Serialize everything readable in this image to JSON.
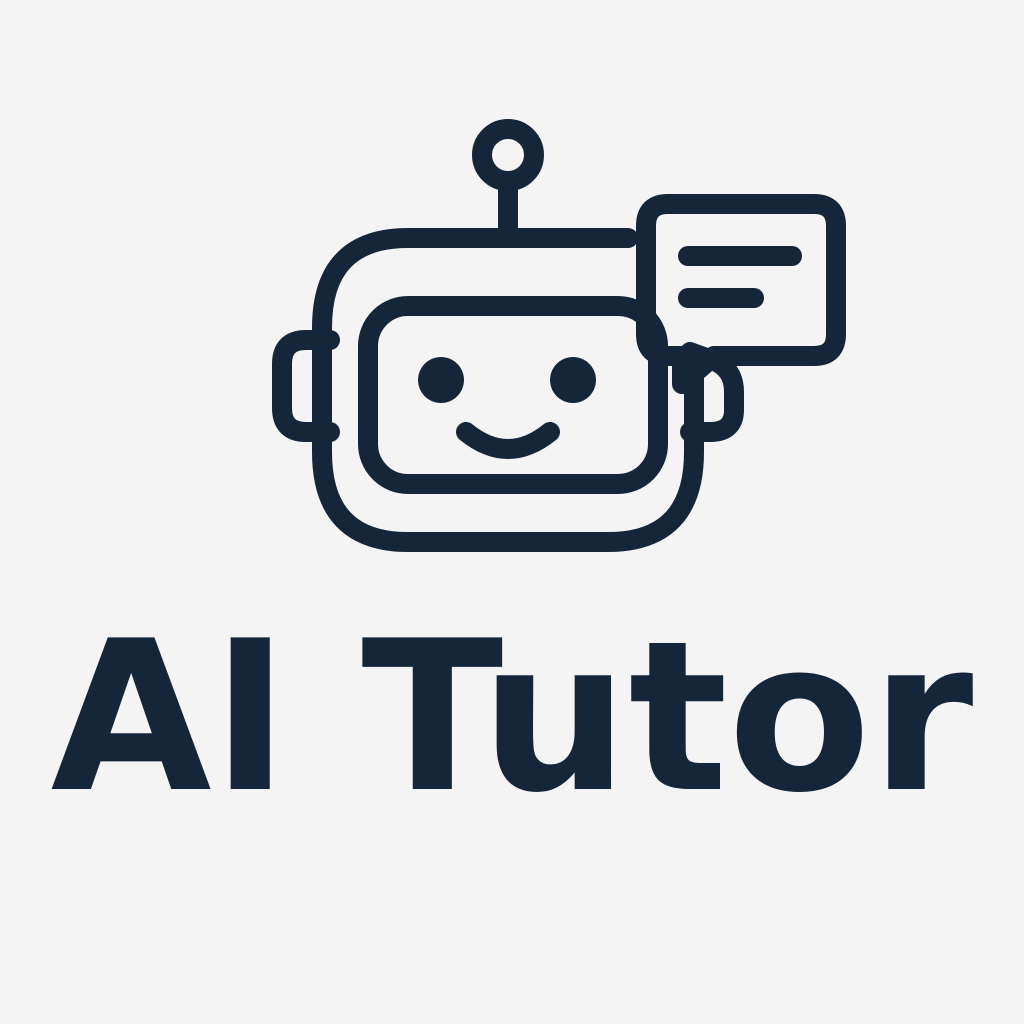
{
  "brand": {
    "name": "AI Tutor",
    "ink_color": "#15263b",
    "background_color": "#f4f4f4"
  },
  "icons": {
    "main": "robot-head-icon",
    "bubble": "speech-bubble-icon"
  }
}
